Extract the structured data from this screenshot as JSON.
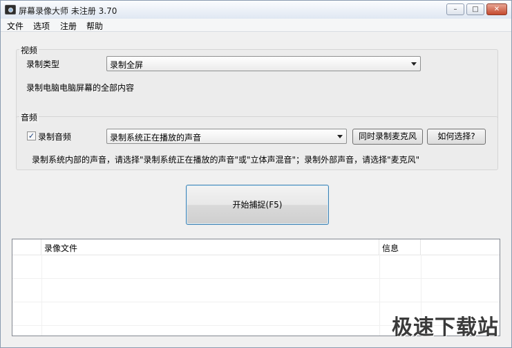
{
  "window": {
    "title": "屏幕录像大师 未注册 3.70",
    "minimize_icon": "minimize-icon",
    "maximize_icon": "maximize-icon",
    "close_icon": "close-icon"
  },
  "menu": [
    "文件",
    "选项",
    "注册",
    "帮助"
  ],
  "video": {
    "group_title": "视频",
    "record_type_label": "录制类型",
    "record_type_value": "录制全屏",
    "description": "录制电脑电脑屏幕的全部内容"
  },
  "audio": {
    "group_title": "音频",
    "record_audio_label": "录制音频",
    "record_audio_checked": true,
    "source_value": "录制系统正在播放的声音",
    "mic_button": "同时录制麦克风",
    "help_button": "如何选择?",
    "hint": "录制系统内部的声音，请选择\"录制系统正在播放的声音\"或\"立体声混音\"；录制外部声音，请选择\"麦克风\""
  },
  "start_button": "开始捕捉(F5)",
  "table": {
    "headers": [
      "",
      "录像文件",
      "信息",
      ""
    ],
    "rows": [
      [
        "",
        "",
        "",
        ""
      ],
      [
        "",
        "",
        "",
        ""
      ],
      [
        "",
        "",
        "",
        ""
      ],
      [
        "",
        "",
        "",
        ""
      ]
    ]
  },
  "watermark": "极速下载站"
}
